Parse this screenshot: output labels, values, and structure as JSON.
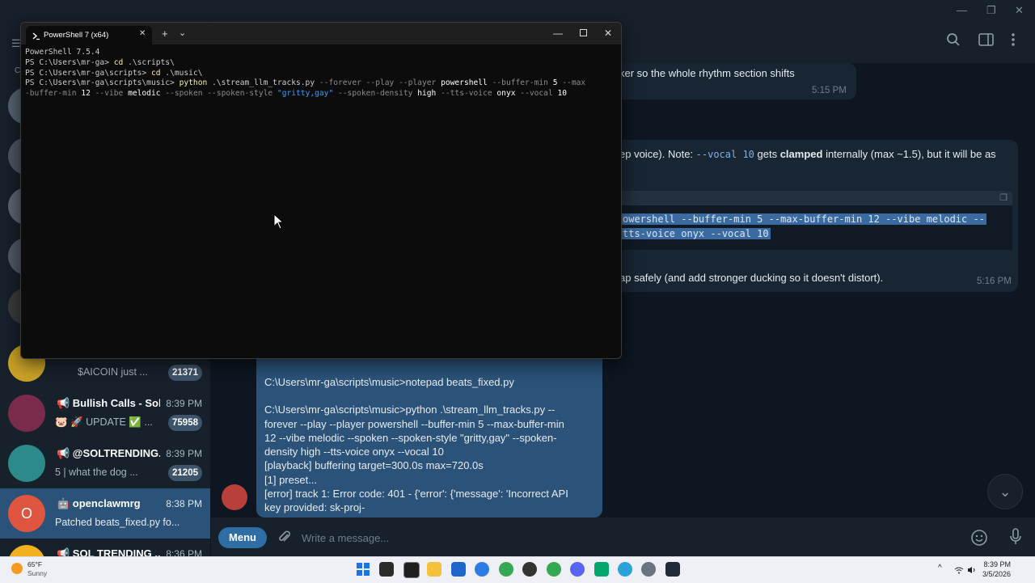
{
  "window_controls": {
    "minimize": "—",
    "maximize": "❐",
    "close": "✕"
  },
  "telegram": {
    "chat_list": [
      {
        "name": "",
        "preview": "$AICOIN just ...",
        "time": "",
        "badge": "21371",
        "avatar_color": "#c9a227"
      },
      {
        "name": "📢 Bullish Calls - Sol...",
        "preview": "🐷 🚀 UPDATE ✅ ...",
        "time": "8:39 PM",
        "badge": "75958",
        "avatar_color": "#7a2a4a"
      },
      {
        "name": "📢 @SOLTRENDING...",
        "preview": "5 | what the dog ...",
        "time": "8:39 PM",
        "badge": "21205",
        "avatar_color": "#2c8a8a"
      },
      {
        "name": "🤖 openclawmrg",
        "preview": "Patched beats_fixed.py fo...",
        "preview_code": "beats_fixed.py",
        "time": "8:38 PM",
        "badge": "",
        "avatar_letter": "O",
        "avatar_color": "#e0553f",
        "active": true
      },
      {
        "name": "📢 SOL TRENDING ...",
        "preview": "",
        "time": "8:36 PM",
        "badge": "",
        "avatar_color": "#f2b01e"
      }
    ],
    "partial_avatar_letter": "C",
    "messages": {
      "m1_text": "ker so the whole rhythm section shifts",
      "m1_time": "5:15 PM",
      "m2_pre": "ep voice). Note: ",
      "m2_code": "--vocal 10",
      "m2_mid": " gets ",
      "m2_bold": "clamped",
      "m2_post": " internally (max ~1.5), but it will be as",
      "code_line1": "owershell --buffer-min 5 --max-buffer-min 12 --vibe melodic --",
      "code_line2": "tts-voice onyx --vocal 10",
      "m3_text": "ap safely (and add stronger ducking so it doesn't distort).",
      "m3_time": "5:16 PM"
    },
    "out_message": {
      "lines": [
        "C:\\Users\\mr-ga\\scripts\\music>notepad beats_fixed.py",
        "",
        "C:\\Users\\mr-ga\\scripts\\music>python .\\stream_llm_tracks.py --",
        "forever --play --player powershell --buffer-min 5 --max-buffer-min",
        "12 --vibe melodic --spoken --spoken-style \"gritty,gay\" --spoken-",
        "density high --tts-voice onyx --vocal 10",
        "[playback] buffering target=300.0s max=720.0s",
        "[1] preset...",
        "[error] track 1: Error code: 401 - {'error': {'message': 'Incorrect API",
        "key provided: sk-proj-"
      ]
    },
    "composer": {
      "menu_label": "Menu",
      "placeholder": "Write a message..."
    },
    "header_icons": [
      "search-icon",
      "sidebar-toggle-icon",
      "more-icon"
    ],
    "scroll_down_icon": "⌄"
  },
  "powershell": {
    "tab_title": "PowerShell 7 (x64)",
    "tab_close": "✕",
    "new_tab": "+",
    "tab_dropdown": "⌄",
    "lines": {
      "l1": "PowerShell 7.5.4",
      "l2_prompt": "PS C:\\Users\\mr-ga> ",
      "l2_cmd": "cd",
      "l2_arg": " .\\scripts\\",
      "l3_prompt": "PS C:\\Users\\mr-ga\\scripts> ",
      "l3_cmd": "cd",
      "l3_arg": " .\\music\\",
      "l4_prompt": "PS C:\\Users\\mr-ga\\scripts\\music> ",
      "l4_cmd": "python",
      "l4_a": " .\\stream_llm_tracks.py ",
      "l4_f1": "--forever --play --player ",
      "l4_v1": "powershell ",
      "l4_f2": "--buffer-min ",
      "l4_v2": "5 ",
      "l4_f3": "--max",
      "l5_f1": "-buffer-min ",
      "l5_v1": "12 ",
      "l5_f2": "--vibe ",
      "l5_v2": "melodic ",
      "l5_f3": "--spoken --spoken-style ",
      "l5_s": "\"gritty,gay\"",
      "l5_f4": " --spoken-density ",
      "l5_v3": "high ",
      "l5_f5": "--tts-voice ",
      "l5_v4": "onyx ",
      "l5_f6": "--vocal ",
      "l5_v5": "10"
    }
  },
  "taskbar": {
    "weather_temp": "65°F",
    "weather_desc": "Sunny",
    "time": "8:39 PM",
    "date": "3/5/2026",
    "tray_chevron": "^"
  }
}
